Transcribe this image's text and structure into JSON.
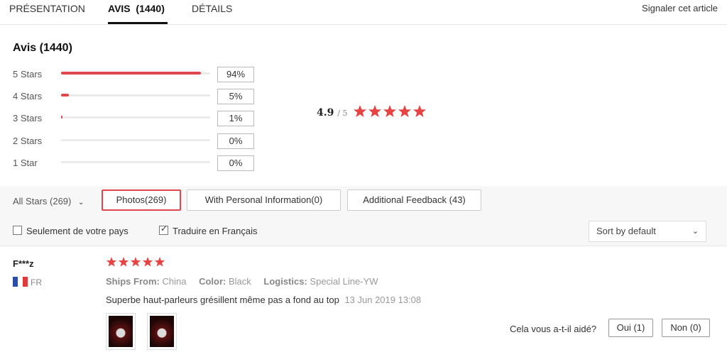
{
  "tabs": [
    {
      "label": "PRÉSENTATION"
    },
    {
      "label": "AVIS  (1440)"
    },
    {
      "label": "DÉTAILS"
    }
  ],
  "report_link": "Signaler cet article",
  "reviews_title": "Avis (1440)",
  "histogram": [
    {
      "label": "5 Stars",
      "percent": "94%",
      "fill": 0.94
    },
    {
      "label": "4 Stars",
      "percent": "5%",
      "fill": 0.05
    },
    {
      "label": "3 Stars",
      "percent": "1%",
      "fill": 0.01
    },
    {
      "label": "2 Stars",
      "percent": "0%",
      "fill": 0
    },
    {
      "label": "1 Star",
      "percent": "0%",
      "fill": 0
    }
  ],
  "average": {
    "score": "4.9",
    "denominator": "/ 5",
    "stars": 5
  },
  "filters": {
    "stars_dropdown": "All Stars (269)",
    "photos": "Photos(269)",
    "personal_info": "With Personal Information(0)",
    "additional_feedback": "Additional Feedback (43)"
  },
  "options": {
    "only_country": {
      "label": "Seulement de votre pays",
      "checked": false
    },
    "translate": {
      "label": "Traduire en Français",
      "checked": true
    }
  },
  "sort": {
    "selected": "Sort by default"
  },
  "review": {
    "user": "F***z",
    "country": "FR",
    "stars": 5,
    "ships_from_label": "Ships From:",
    "ships_from": "China",
    "color_label": "Color:",
    "color": "Black",
    "logistics_label": "Logistics:",
    "logistics": "Special Line-YW",
    "text": "Superbe haut-parleurs grésillent même pas a fond au top",
    "date": "13 Jun 2019 13:08",
    "helpful_question": "Cela vous a-t-il aidé?",
    "yes_label": "Oui (1)",
    "no_label": "Non (0)"
  },
  "colors": {
    "accent": "#e0474c",
    "star": "#e84343"
  }
}
